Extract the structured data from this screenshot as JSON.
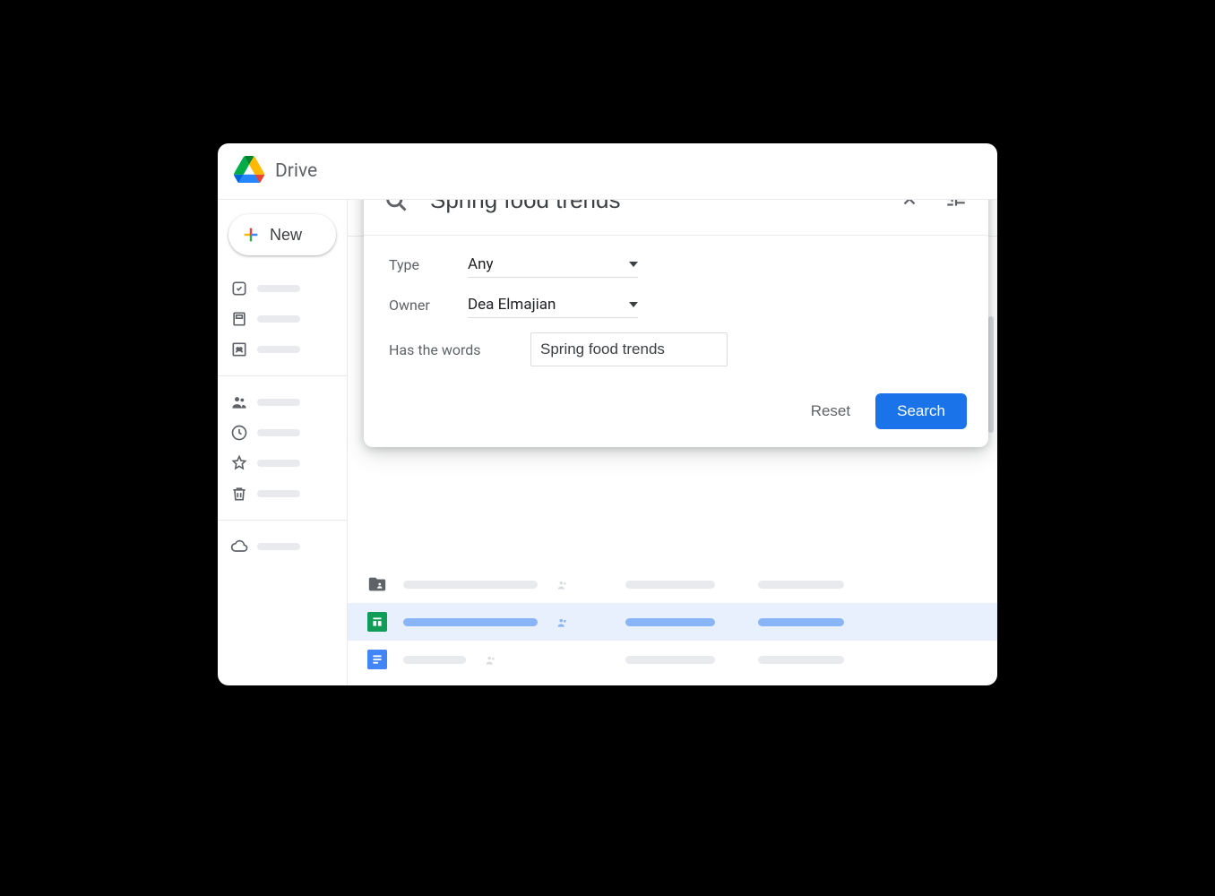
{
  "app": {
    "title": "Drive"
  },
  "sidebar": {
    "new_label": "New"
  },
  "search": {
    "value": "Spring food trends",
    "filters": {
      "type_label": "Type",
      "type_value": "Any",
      "owner_label": "Owner",
      "owner_value": "Dea Elmajian",
      "words_label": "Has the words",
      "words_value": "Spring food trends"
    },
    "actions": {
      "reset": "Reset",
      "search": "Search"
    }
  },
  "files": [
    {
      "type": "folder",
      "selected": false
    },
    {
      "type": "sheets",
      "selected": true
    },
    {
      "type": "docs",
      "selected": false
    }
  ]
}
